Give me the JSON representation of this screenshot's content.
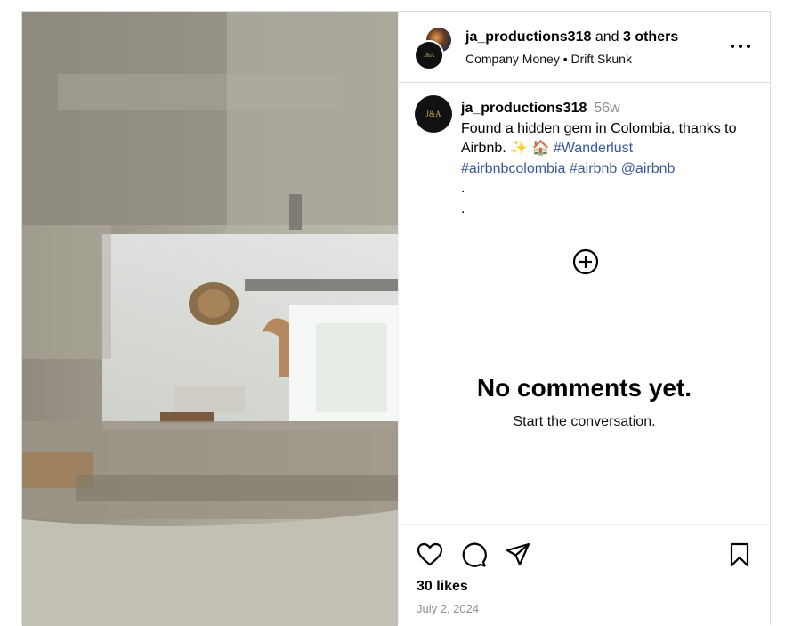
{
  "header": {
    "username": "ja_productions318",
    "joiner": "and",
    "others": "3 others",
    "audio_track": "Company Money • Drift Skunk",
    "avatar_text": "J&A"
  },
  "caption": {
    "username": "ja_productions318",
    "age": "56w",
    "text": "Found a hidden gem in Colombia, thanks to Airbnb. ✨ 🏠",
    "hashtag1": "#Wanderlust",
    "hashtag2": "#airbnbcolombia",
    "hashtag3": "#airbnb",
    "mention": "@airbnb",
    "dot": "."
  },
  "comments": {
    "empty_title": "No comments yet.",
    "empty_subtitle": "Start the conversation."
  },
  "footer": {
    "likes": "30 likes",
    "date": "July 2, 2024"
  },
  "icons": {
    "more": "more-options-icon",
    "add_comment": "add-circle-icon",
    "like": "heart-icon",
    "comment": "comment-bubble-icon",
    "share": "paper-plane-icon",
    "save": "bookmark-icon"
  }
}
